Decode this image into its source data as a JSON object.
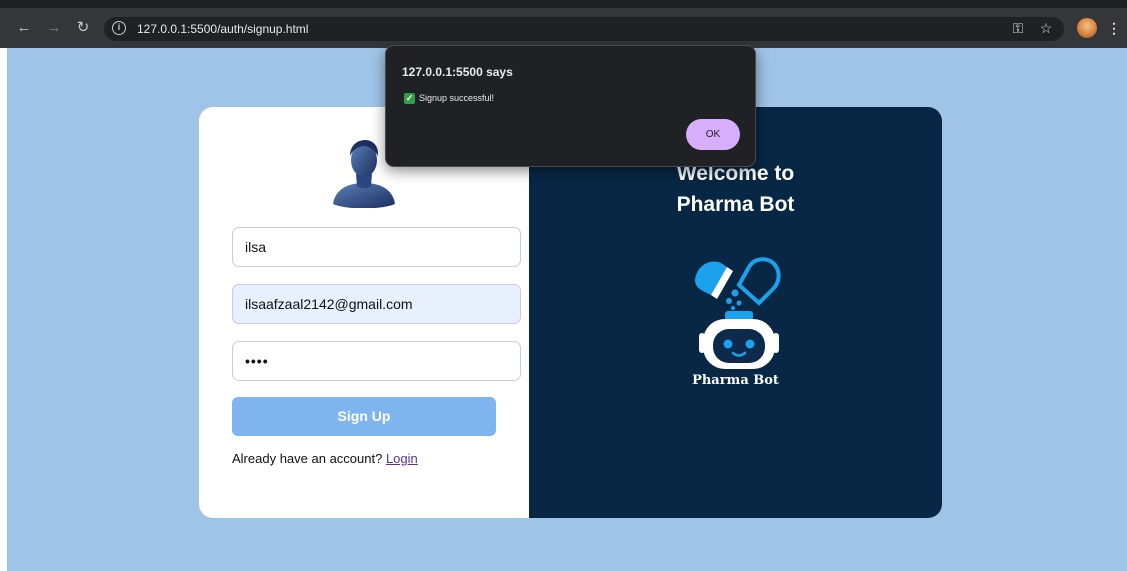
{
  "browser": {
    "url": "127.0.0.1:5500/auth/signup.html",
    "icons": {
      "back": "arrow-left-icon",
      "forward": "arrow-right-icon",
      "reload": "reload-icon",
      "info": "info-icon",
      "password": "key-icon",
      "bookmark": "star-icon",
      "menu": "more-vert-icon"
    }
  },
  "alert": {
    "title": "127.0.0.1:5500 says",
    "message": "Signup successful!",
    "ok_label": "OK"
  },
  "form": {
    "name_value": "ilsa",
    "email_value": "ilsaafzaal2142@gmail.com",
    "password_value": "••••",
    "signup_label": "Sign Up",
    "account_prompt": "Already have an account?",
    "login_label": "Login"
  },
  "brand": {
    "welcome_line1": "Welcome to",
    "welcome_line2": "Pharma Bot",
    "logo_text": "Pharma Bot"
  },
  "colors": {
    "page_bg": "#a0c4e8",
    "panel_dark": "#072744",
    "button": "#7fb5ee",
    "alert_ok": "#d7aefb"
  }
}
